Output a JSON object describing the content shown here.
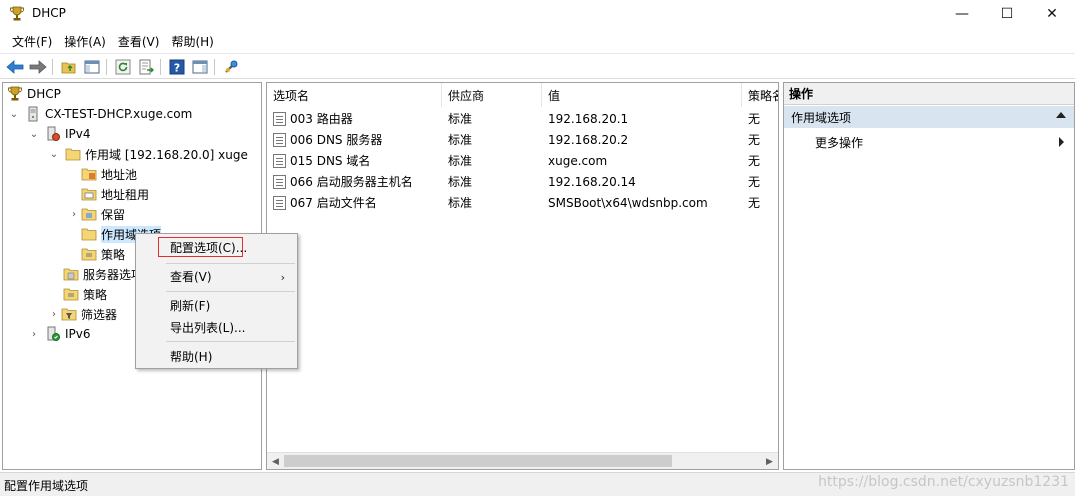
{
  "window": {
    "title": "DHCP",
    "controls": [
      "—",
      "☐",
      "✕"
    ]
  },
  "menubar": [
    "文件(F)",
    "操作(A)",
    "查看(V)",
    "帮助(H)"
  ],
  "tree": {
    "root": "DHCP",
    "server": "CX-TEST-DHCP.xuge.com",
    "ipv4": "IPv4",
    "scope": "作用域 [192.168.20.0] xuge",
    "address_pool": "地址池",
    "address_leases": "地址租用",
    "reservations": "保留",
    "scope_options": "作用域选项",
    "policies_scope": "策略",
    "server_options": "服务器选项",
    "policies": "策略",
    "filters": "筛选器",
    "ipv6": "IPv6"
  },
  "list": {
    "columns": [
      "选项名",
      "供应商",
      "值",
      "策略名"
    ],
    "rows": [
      {
        "name": "003 路由器",
        "vendor": "标准",
        "value": "192.168.20.1",
        "policy": "无"
      },
      {
        "name": "006 DNS 服务器",
        "vendor": "标准",
        "value": "192.168.20.2",
        "policy": "无"
      },
      {
        "name": "015 DNS 域名",
        "vendor": "标准",
        "value": "xuge.com",
        "policy": "无"
      },
      {
        "name": "066 启动服务器主机名",
        "vendor": "标准",
        "value": "192.168.20.14",
        "policy": "无"
      },
      {
        "name": "067 启动文件名",
        "vendor": "标准",
        "value": "SMSBoot\\x64\\wdsnbp.com",
        "policy": "无"
      }
    ]
  },
  "actions": {
    "header": "操作",
    "section": "作用域选项",
    "more": "更多操作"
  },
  "context_menu": {
    "configure": "配置选项(C)...",
    "view": "查看(V)",
    "refresh": "刷新(F)",
    "export": "导出列表(L)...",
    "help": "帮助(H)"
  },
  "status": "配置作用域选项",
  "watermark": "https://blog.csdn.net/cxyuzsnb1231",
  "colors": {
    "selection": "#cce8ff",
    "action_section": "#d9e4f1",
    "highlight_box": "#e03030"
  }
}
